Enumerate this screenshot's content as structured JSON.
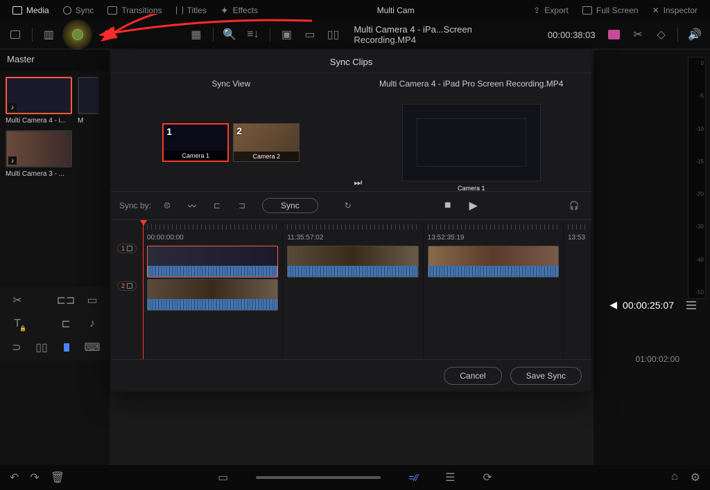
{
  "topbar": {
    "media": "Media",
    "sync": "Sync",
    "transitions": "Transitions",
    "titles": "Titles",
    "effects": "Effects",
    "center": "Multi Cam",
    "export": "Export",
    "fullscreen": "Full Screen",
    "inspector": "Inspector"
  },
  "toolbar2": {
    "clip_title": "Multi Camera 4 - iPa...Screen Recording.MP4",
    "timecode": "00:00:38:03"
  },
  "sidebar": {
    "master": "Master",
    "thumbs": [
      {
        "label": "Multi Camera 4 - i...",
        "sel": true
      },
      {
        "label": "M",
        "sel": false,
        "half": true
      },
      {
        "label": "Multi Camera 3 - ...",
        "sel": false
      }
    ]
  },
  "sync_panel": {
    "title": "Sync Clips",
    "left_header": "Sync View",
    "right_header": "Multi Camera 4 - iPad Pro Screen Recording.MP4",
    "cam1_num": "1",
    "cam1_lbl": "Camera 1",
    "cam2_num": "2",
    "cam2_lbl": "Camera 2",
    "preview_lbl": "Camera 1",
    "syncby": "Sync by:",
    "sync_btn": "Sync",
    "tracks": [
      {
        "tc": "00:00:00:00"
      },
      {
        "tc": "11:35:57:02"
      },
      {
        "tc": "13:52:35:19"
      },
      {
        "tc": "13:53"
      }
    ],
    "track_labels": [
      "1",
      "2"
    ],
    "cancel": "Cancel",
    "save": "Save Sync"
  },
  "right": {
    "tc": "00:00:25:07",
    "tc2": "01:00:02:00",
    "meter": [
      "0",
      "-5",
      "-10",
      "-15",
      "-20",
      "-30",
      "-40",
      "-50"
    ]
  }
}
